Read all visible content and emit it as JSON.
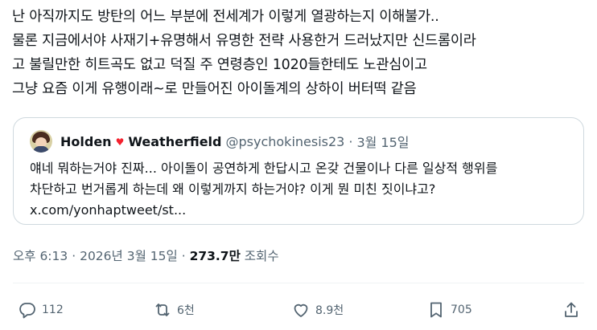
{
  "tweet": {
    "lines": [
      "난 아직까지도 방탄의 어느 부분에 전세계가 이렇게 열광하는지 이해불가..",
      "물론 지금에서야 사재기+유명해서 유명한 전략 사용한거 드러났지만 신드롬이라",
      "고 불릴만한 히트곡도 없고 덕질 주 연령층인 1020들한테도 노관심이고",
      "그냥 요즘 이게 유행이래~로 만들어진 아이돌계의 상하이 버터떡 같음"
    ]
  },
  "quote": {
    "name_first": "Holden",
    "heart": "♥",
    "name_last": "Weatherfield",
    "handle": "@psychokinesis23",
    "separator": "·",
    "date": "3월 15일",
    "lines": [
      "얘네 뭐하는거야 진짜... 아이돌이 공연하게 한답시고 온갖 건물이나 다른 일상적 행위를",
      "차단하고 번거롭게 하는데 왜 이렇게까지 하는거야? 이게 뭔 미친 짓이냐고?",
      "x.com/yonhaptweet/st..."
    ]
  },
  "meta": {
    "time": "오후 6:13",
    "sep1": "·",
    "date": "2026년 3월 15일",
    "sep2": "·",
    "views_count": "273.7만",
    "views_label": "조회수"
  },
  "actions": {
    "replies": "112",
    "reposts": "6천",
    "likes": "8.9천",
    "bookmarks": "705"
  },
  "icons": {
    "reply": "reply-icon",
    "repost": "repost-icon",
    "like": "heart-icon",
    "bookmark": "bookmark-icon",
    "share": "share-icon"
  },
  "colors": {
    "text": "#0f1419",
    "secondary": "#536471",
    "border": "#cfd9de",
    "heart_emoji": "#f4212e"
  }
}
